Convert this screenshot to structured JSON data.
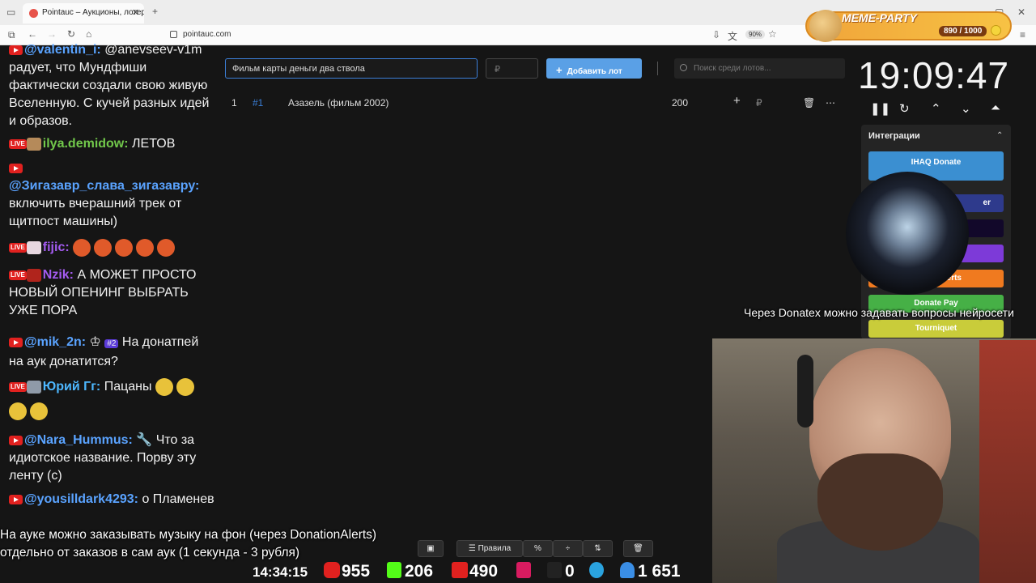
{
  "browser": {
    "tab_title": "Pointauc – Аукционы, лотере",
    "url": "pointauc.com",
    "zoom": "90%"
  },
  "meme_party": {
    "title": "MEME-PARTY",
    "count": "890 / 1000"
  },
  "chat": [
    {
      "user": "@valentin_i:",
      "text": "@anevseev-v1m радует, что Мундфиши фактически создали свою живую Вселенную. С кучей разных идей и образов."
    },
    {
      "user": "ilya.demidow:",
      "text": "ЛЕТОВ"
    },
    {
      "user": "@Зигазавр_слава_зигазавру:",
      "text": "включить вчерашний трек от щитпост машины)"
    },
    {
      "user": "fijic:",
      "text": ""
    },
    {
      "user": "Nzik:",
      "text": "А МОЖЕТ ПРОСТО НОВЫЙ ОПЕНИНГ ВЫБРАТЬ УЖЕ ПОРА"
    },
    {
      "user": "@mik_2n:",
      "badge": "#2",
      "text": "На донатпей на аук донатится?"
    },
    {
      "user": "Юрий Гг:",
      "text": "Пацаны"
    },
    {
      "user": "@Nara_Hummus:",
      "text": "Что за идиотское название. Порву эту ленту (с)"
    },
    {
      "user": "@yousilldark4293:",
      "text": "о Пламенев"
    }
  ],
  "auction": {
    "lot_input_value": "Фильм карты деньги два ствола",
    "amount_placeholder": "₽",
    "add_button": "Добавить лот",
    "search_placeholder": "Поиск среди лотов...",
    "lots": [
      {
        "index": "1",
        "id": "#1",
        "name": "Азазель (фильм 2002)",
        "amount": "200",
        "currency": "₽"
      }
    ]
  },
  "timer": {
    "time": "19:09:47"
  },
  "integrations": {
    "title": "Интеграции",
    "items": [
      {
        "label": "IHAQ Donate",
        "color": "#3b8fd1"
      },
      {
        "label": "er",
        "color": "#2e3a8c"
      },
      {
        "label": "",
        "color": "#12082a"
      },
      {
        "label": "",
        "color": "#7d3ad8"
      },
      {
        "label": "Alerts",
        "color": "#f07a1f"
      },
      {
        "label": "Donate Pay",
        "color": "#46b046"
      },
      {
        "label": "Tourniquet",
        "color": "#c9cc3a"
      }
    ]
  },
  "captions": {
    "donatex": "Через Donatex можно задавать вопросы нейросети",
    "music_line1": "На ауке можно заказывать музыку на фон (через DonationAlerts)",
    "music_line2": "отдельно от заказов в сам аук (1 секунда - 3 рубля)"
  },
  "toolbar": {
    "rules": "Правила",
    "percent": "%"
  },
  "status": {
    "time": "14:34:15",
    "youtube": "955",
    "kick": "206",
    "vkplay": "490",
    "rutube": "0",
    "viewers": "1 651"
  }
}
